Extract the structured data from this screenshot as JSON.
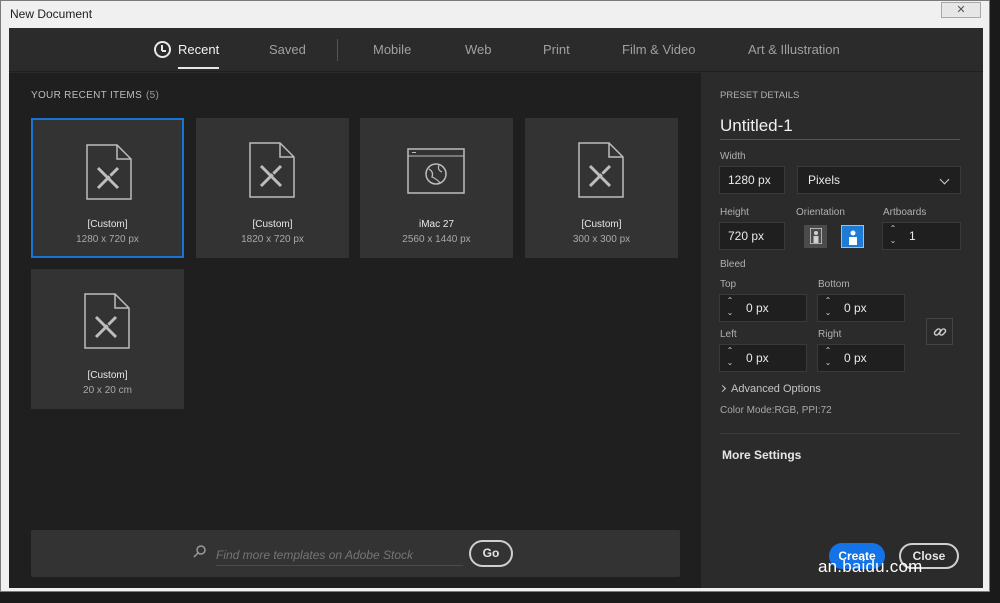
{
  "window": {
    "title": "New Document",
    "close_label": "✕"
  },
  "tabs": [
    {
      "label": "Recent",
      "active": true
    },
    {
      "label": "Saved"
    },
    {
      "label": "Mobile"
    },
    {
      "label": "Web"
    },
    {
      "label": "Print"
    },
    {
      "label": "Film & Video"
    },
    {
      "label": "Art & Illustration"
    }
  ],
  "recent": {
    "heading": "YOUR RECENT ITEMS",
    "count": "(5)",
    "items": [
      {
        "name": "[Custom]",
        "size": "1280 x 720 px",
        "icon": "document-icon",
        "selected": true
      },
      {
        "name": "[Custom]",
        "size": "1820 x 720 px",
        "icon": "document-icon"
      },
      {
        "name": "iMac 27",
        "size": "2560 x 1440 px",
        "icon": "screen-icon"
      },
      {
        "name": "[Custom]",
        "size": "300 x 300 px",
        "icon": "document-icon"
      },
      {
        "name": "[Custom]",
        "size": "20 x 20 cm",
        "icon": "document-icon"
      }
    ]
  },
  "search": {
    "placeholder": "Find more templates on Adobe Stock",
    "go_label": "Go"
  },
  "preset": {
    "heading": "PRESET DETAILS",
    "name": "Untitled-1",
    "width_label": "Width",
    "width_value": "1280 px",
    "unit": "Pixels",
    "height_label": "Height",
    "height_value": "720 px",
    "orientation_label": "Orientation",
    "artboards_label": "Artboards",
    "artboards_value": "1",
    "bleed_label": "Bleed",
    "top_label": "Top",
    "top_value": "0 px",
    "bottom_label": "Bottom",
    "bottom_value": "0 px",
    "left_label": "Left",
    "left_value": "0 px",
    "right_label": "Right",
    "right_value": "0 px",
    "advanced_label": "Advanced Options",
    "color_mode": "Color Mode:RGB, PPI:72",
    "more_settings": "More Settings",
    "create_label": "Create",
    "close_label": "Close"
  },
  "watermark": "an.baidu.com",
  "colors": {
    "accent": "#1473e6",
    "selected_border": "#1c73d6"
  }
}
